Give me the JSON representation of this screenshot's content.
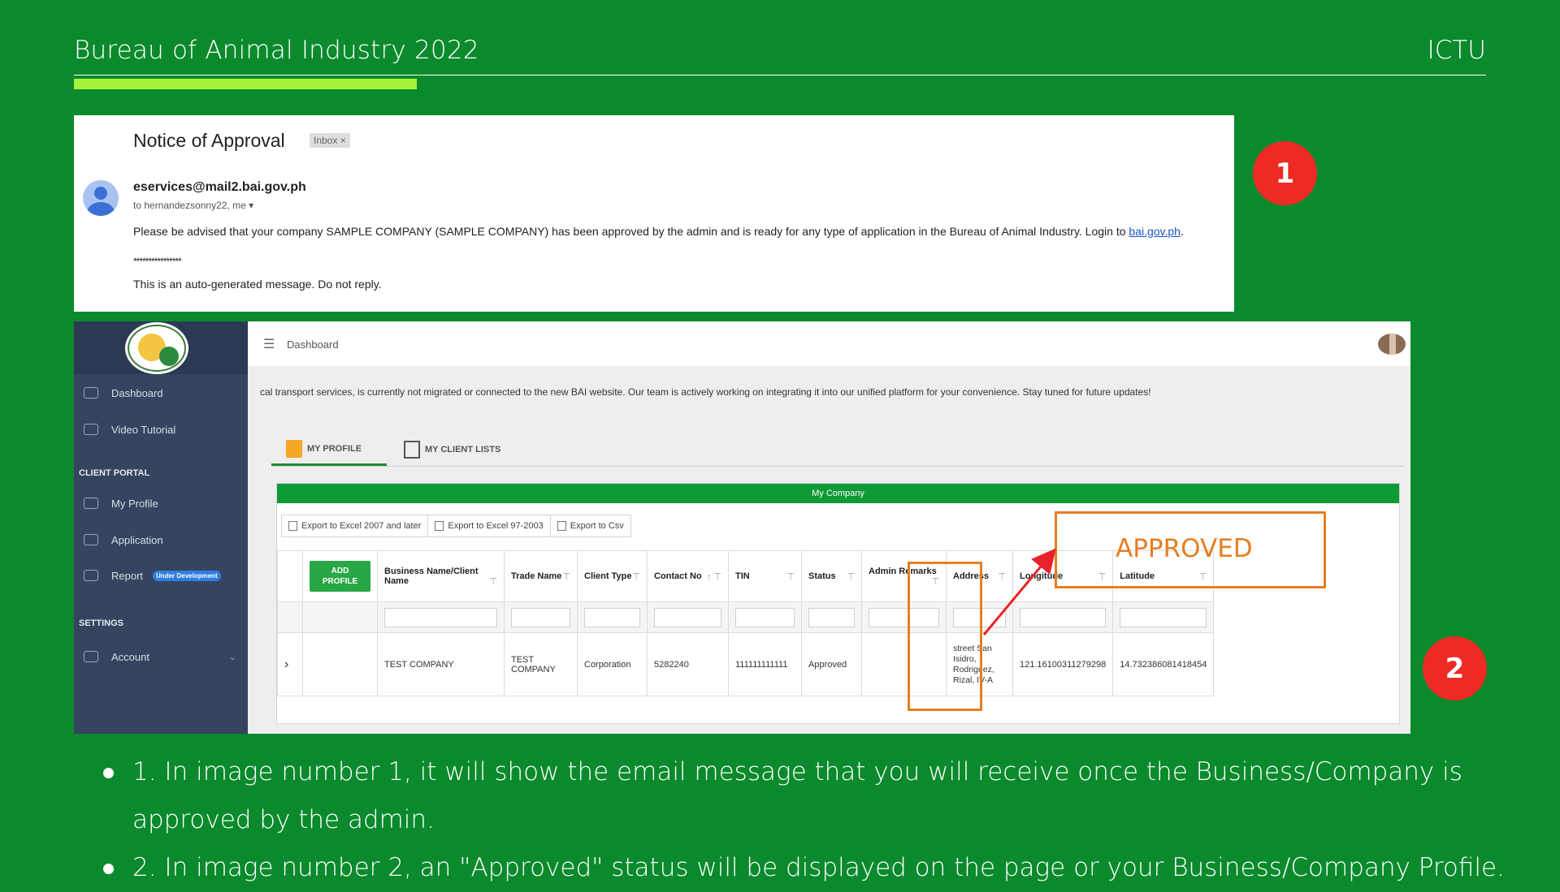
{
  "slide": {
    "title": "Bureau of Animal Industry 2022",
    "org": "ICTU",
    "colors": {
      "background": "#0a8a2c",
      "accent": "#a6f23a",
      "badge": "#ee2a24",
      "highlight": "#e67e22"
    }
  },
  "email": {
    "subject": "Notice of Approval",
    "tag": "Inbox ×",
    "sender": "eservices@mail2.bai.gov.ph",
    "to_line": "to hernandezsonny22, me ▾",
    "body": "Please be advised that your company SAMPLE COMPANY (SAMPLE COMPANY) has been approved by the admin and is ready for any type of application in the Bureau of Animal Industry. Login to ",
    "link": "bai.gov.ph",
    "body_end": ".",
    "stars": "****************",
    "auto": "This is an auto-generated message. Do not reply."
  },
  "badges": {
    "one": "1",
    "two": "2"
  },
  "app": {
    "sidebar": {
      "items": [
        {
          "label": "Dashboard",
          "icon": "dashboard-icon"
        },
        {
          "label": "Video Tutorial",
          "icon": "video-icon"
        }
      ],
      "client_portal_label": "CLIENT PORTAL",
      "portal_items": [
        {
          "label": "My Profile",
          "icon": "profile-icon"
        },
        {
          "label": "Application",
          "icon": "application-icon"
        },
        {
          "label": "Report",
          "icon": "pencil-icon",
          "badge": "Under Development"
        }
      ],
      "settings_label": "SETTINGS",
      "account_label": "Account"
    },
    "topbar": {
      "title": "Dashboard"
    },
    "banner": "cal transport services, is currently not migrated or connected to the new BAI website. Our team is actively working on integrating it into our unified platform for your convenience. Stay tuned for future updates!",
    "tabs": [
      {
        "label": "MY PROFILE"
      },
      {
        "label": "MY CLIENT LISTS"
      }
    ],
    "grid": {
      "title": "My Company",
      "exports": [
        "Export to Excel 2007 and later",
        "Export to Excel 97-2003",
        "Export to Csv"
      ],
      "add_button": "ADD PROFILE",
      "columns": [
        "Business Name/Client Name",
        "Trade Name",
        "Client Type",
        "Contact No",
        "TIN",
        "Status",
        "Admin Remarks",
        "Address",
        "Longitude",
        "Latitude"
      ],
      "row": {
        "expand": "›",
        "business": "TEST COMPANY",
        "trade": "TEST COMPANY",
        "client_type": "Corporation",
        "contact": "5282240",
        "tin": "111111111111",
        "status": "Approved",
        "remarks": "",
        "address": "street San Isidro, Rodriguez, Rizal, IV-A",
        "longitude": "121.16100311279298",
        "latitude": "14.732386081418454"
      }
    },
    "callout": "APPROVED"
  },
  "notes": [
    "1. In image number 1, it will show the email message that you will receive once the Business/Company is approved by the admin.",
    "2. In image number 2, an \"Approved\" status will be displayed on the page or your Business/Company Profile."
  ]
}
